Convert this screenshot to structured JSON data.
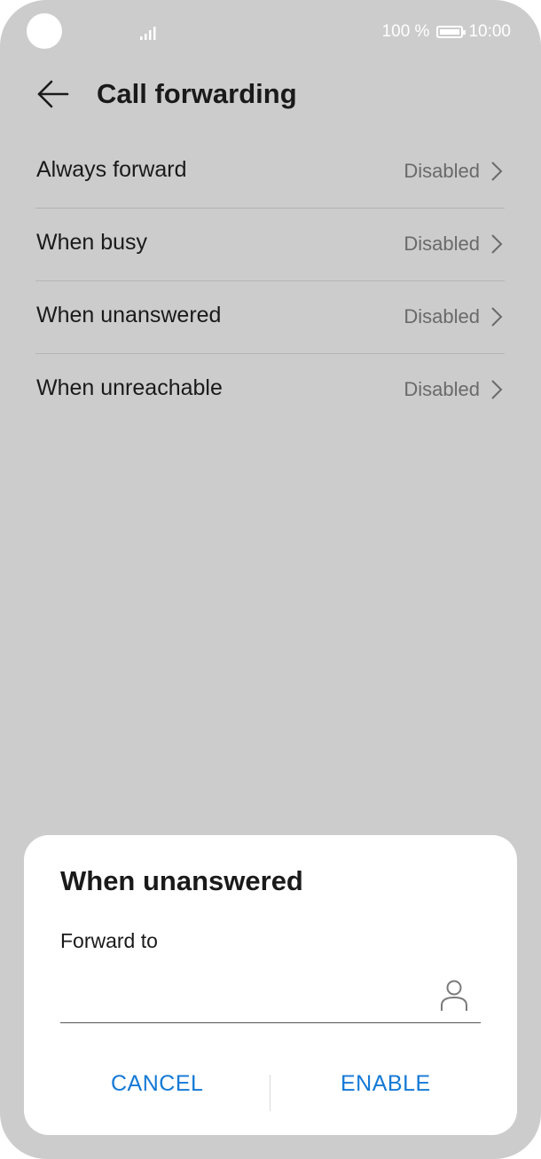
{
  "status_bar": {
    "battery_text": "100 %",
    "time": "10:00",
    "icons": [
      "signal-icon",
      "battery-icon"
    ]
  },
  "header": {
    "title": "Call forwarding",
    "back_icon": "arrow-left-icon"
  },
  "forwarding_options": [
    {
      "label": "Always forward",
      "value": "Disabled"
    },
    {
      "label": "When busy",
      "value": "Disabled"
    },
    {
      "label": "When unanswered",
      "value": "Disabled"
    },
    {
      "label": "When unreachable",
      "value": "Disabled"
    }
  ],
  "dialog": {
    "title": "When unanswered",
    "field_label": "Forward to",
    "field_value": "",
    "contact_icon": "contact-person-icon",
    "cancel_label": "CANCEL",
    "enable_label": "ENABLE"
  },
  "colors": {
    "background_dim": "#cccccc",
    "accent": "#1479d6",
    "dialog_background": "#ffffff"
  }
}
